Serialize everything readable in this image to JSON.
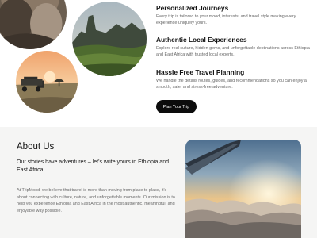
{
  "features": [
    {
      "title": "Personalized Journeys",
      "text": "Every trip is tailored to your mood, interests, and travel style making every experience uniquely yours."
    },
    {
      "title": "Authentic Local Experiences",
      "text": "Explore real culture, hidden gems, and unforgettable destinations across Ethiopia and East Africa with trusted local experts."
    },
    {
      "title": "Hassle Free Travel Planning",
      "text": "We handle the details routes, guides, and recommendations so you can enjoy a smooth, safe, and stress-free adventure."
    }
  ],
  "cta": {
    "label": "Plan Your Trip"
  },
  "about": {
    "title": "About Us",
    "lead": "Our stories have adventures – let's write yours in Ethiopia and East Africa.",
    "body": "At TripMood, we believe that travel is more than moving from place to place, it's about connecting with culture, nature, and unforgettable moments. Our mission is to help you experience Ethiopia and East Africa in the most authentic, meaningful, and enjoyable way possible."
  },
  "images": [
    "portrait-photo",
    "mountain-landscape-photo",
    "safari-sunset-photo",
    "airplane-wing-sky-photo"
  ],
  "colors": {
    "accent": "#10b4b0",
    "button": "#0c0c0c",
    "about_bg": "#f5f5f4"
  }
}
